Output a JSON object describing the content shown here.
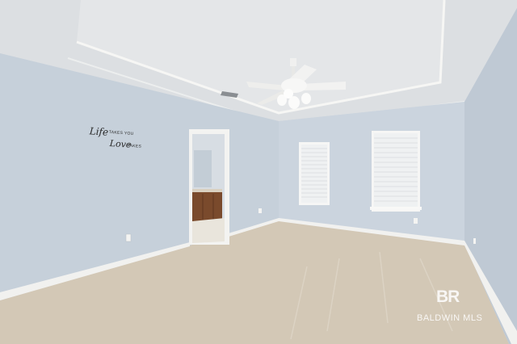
{
  "scene": {
    "description_free": true,
    "colors": {
      "wall": "#c8d1db",
      "wall_right": "#bfc9d4",
      "ceiling": "#dcdfe2",
      "trim": "#f4f4f2",
      "carpet": "#d3c8b6",
      "window_blind": "#f2f3f3",
      "cabinet": "#7a4a2c"
    },
    "wall_decal": {
      "word1": "Life",
      "small1": "TAKES YOU",
      "word2": "Love",
      "small2": "TAKES"
    },
    "watermark": {
      "logo_text": "BR",
      "caption": "BALDWIN MLS"
    }
  }
}
